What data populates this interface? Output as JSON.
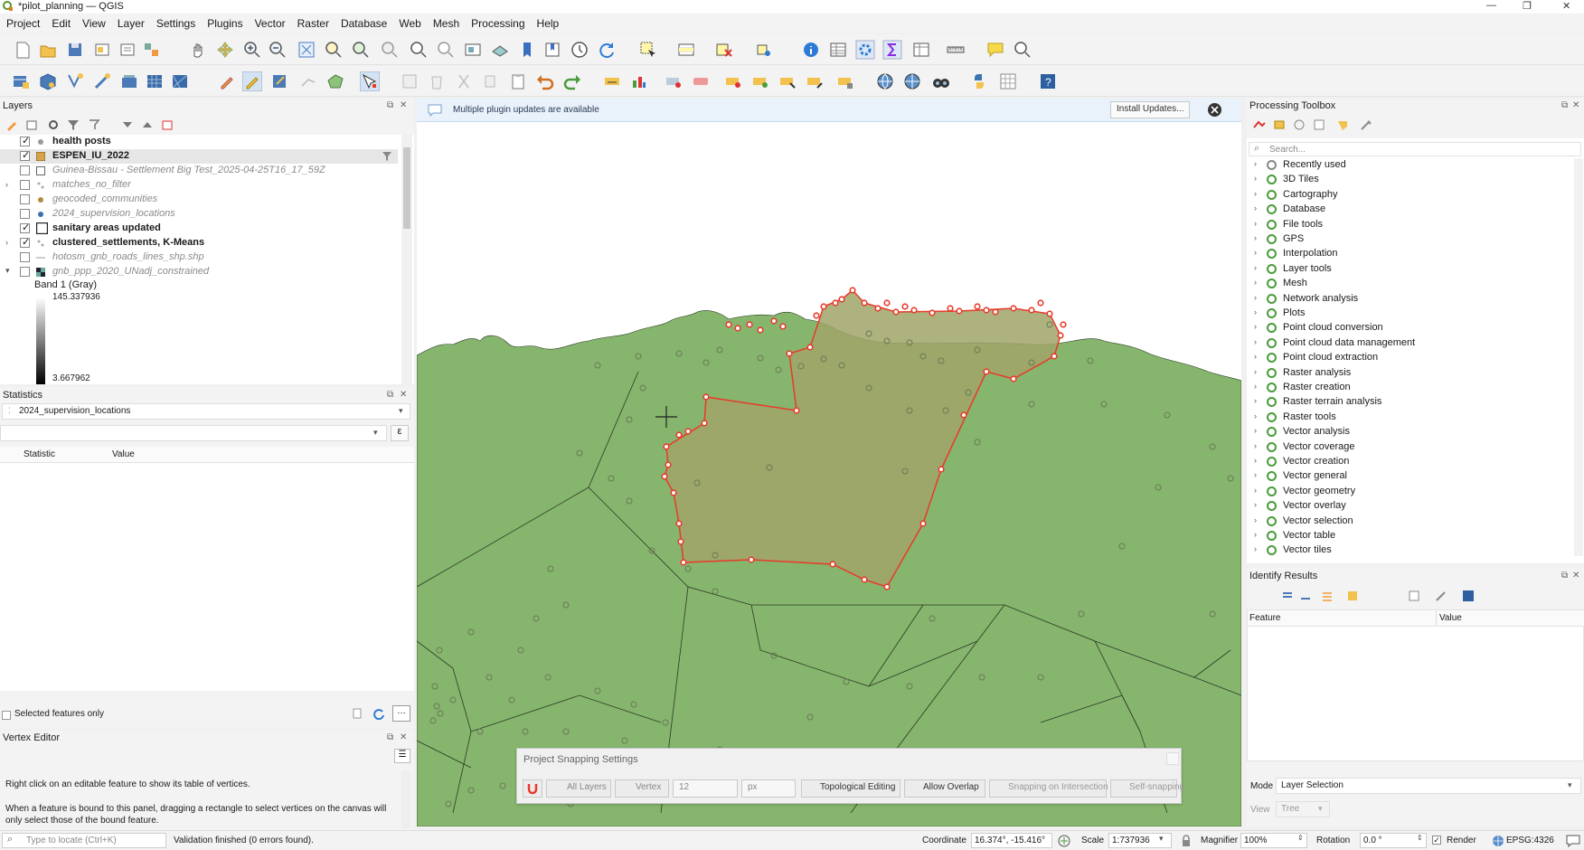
{
  "window": {
    "title": "*pilot_planning — QGIS",
    "controls": [
      "—",
      "❐",
      "✕"
    ]
  },
  "menu": [
    "Project",
    "Edit",
    "View",
    "Layer",
    "Settings",
    "Plugins",
    "Vector",
    "Raster",
    "Database",
    "Web",
    "Mesh",
    "Processing",
    "Help"
  ],
  "layers_panel": {
    "title": "Layers",
    "items": [
      {
        "name": "health posts",
        "checked": true,
        "style": "bold",
        "symbol": "point-gray"
      },
      {
        "name": "ESPEN_IU_2022",
        "checked": true,
        "style": "bold",
        "symbol": "poly-orange",
        "selected": true
      },
      {
        "name": "Guinea-Bissau - Settlement Big Test_2025-04-25T16_17_59Z",
        "checked": false,
        "style": "italic",
        "symbol": "poly-white"
      },
      {
        "name": "matches_no_filter",
        "checked": false,
        "style": "italic",
        "symbol": "dots"
      },
      {
        "name": "geocoded_communities",
        "checked": false,
        "style": "italic",
        "symbol": "point-brown"
      },
      {
        "name": "2024_supervision_locations",
        "checked": false,
        "style": "italic",
        "symbol": "point-blue"
      },
      {
        "name": "sanitary areas updated",
        "checked": true,
        "style": "bold",
        "symbol": "poly-white"
      },
      {
        "name": "clustered_settlements, K-Means",
        "checked": true,
        "style": "bold",
        "symbol": "dots"
      },
      {
        "name": "hotosm_gnb_roads_lines_shp.shp",
        "checked": false,
        "style": "italic",
        "symbol": "line"
      },
      {
        "name": "gnb_ppp_2020_UNadj_constrained",
        "checked": false,
        "style": "italic",
        "symbol": "raster"
      }
    ],
    "band_label": "Band 1 (Gray)",
    "legend_max": "145.337936",
    "legend_min": "3.667962"
  },
  "statistics_panel": {
    "title": "Statistics",
    "layer": "2024_supervision_locations",
    "col_statistic": "Statistic",
    "col_value": "Value",
    "selected_only": "Selected features only"
  },
  "vertex_editor": {
    "title": "Vertex Editor",
    "hint1": "Right click on an editable feature to show its table of vertices.",
    "hint2": "When a feature is bound to this panel, dragging a rectangle to select vertices on the canvas will only select those of the bound feature."
  },
  "notification": {
    "text": "Multiple plugin updates are available",
    "button": "Install Updates..."
  },
  "processing_toolbox": {
    "title": "Processing Toolbox",
    "search_placeholder": "Search...",
    "items": [
      "Recently used",
      "3D Tiles",
      "Cartography",
      "Database",
      "File tools",
      "GPS",
      "Interpolation",
      "Layer tools",
      "Mesh",
      "Network analysis",
      "Plots",
      "Point cloud conversion",
      "Point cloud data management",
      "Point cloud extraction",
      "Raster analysis",
      "Raster creation",
      "Raster terrain analysis",
      "Raster tools",
      "Vector analysis",
      "Vector coverage",
      "Vector creation",
      "Vector general",
      "Vector geometry",
      "Vector overlay",
      "Vector selection",
      "Vector table",
      "Vector tiles"
    ]
  },
  "identify_results": {
    "title": "Identify Results",
    "col_feature": "Feature",
    "col_value": "Value",
    "mode_label": "Mode",
    "mode_value": "Layer Selection",
    "view_label": "View",
    "view_value": "Tree"
  },
  "snapping": {
    "title": "Project Snapping Settings",
    "layers": "All Layers",
    "vertex": "Vertex",
    "tolerance": "12",
    "units": "px",
    "topological": "Topological Editing",
    "overlap": "Allow Overlap",
    "intersection": "Snapping on Intersection",
    "self": "Self-snapping"
  },
  "statusbar": {
    "locate_placeholder": "Type to locate (Ctrl+K)",
    "message": "Validation finished (0 errors found).",
    "coordinate_label": "Coordinate",
    "coordinate": "16.374°, -15.416°",
    "scale_label": "Scale",
    "scale": "1:737936",
    "magnifier_label": "Magnifier",
    "magnifier": "100%",
    "rotation_label": "Rotation",
    "rotation": "0.0 °",
    "render_label": "Render",
    "crs": "EPSG:4326"
  },
  "colors": {
    "map_fill": "#86b56e",
    "edit_poly": "#a0a468",
    "vertex": "#e83a2a",
    "accent": "#2e7bd6"
  }
}
